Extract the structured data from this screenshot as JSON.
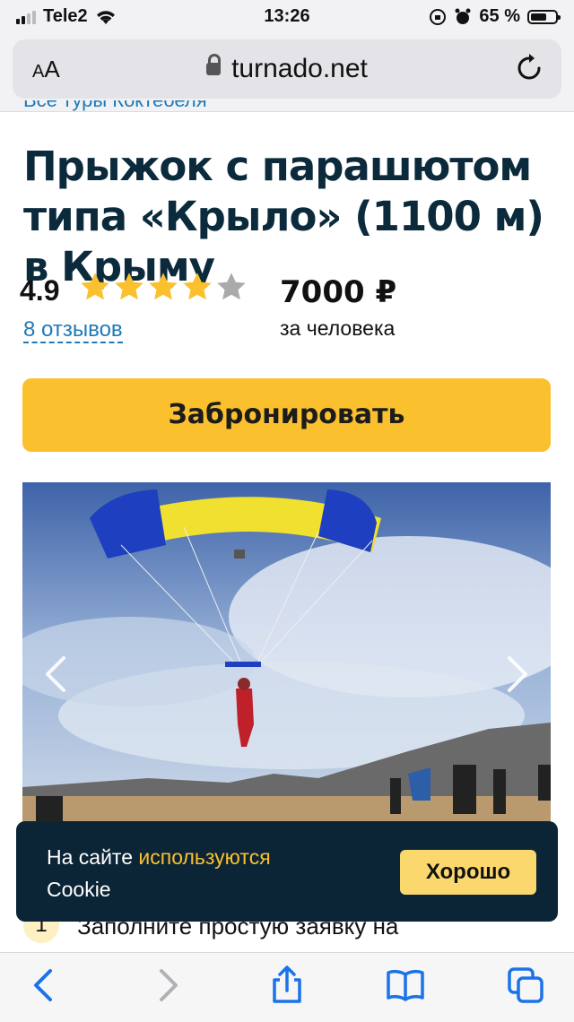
{
  "status_bar": {
    "carrier": "Tele2",
    "time": "13:26",
    "battery": "65 %",
    "battery_level": 0.65
  },
  "browser": {
    "text_size_label": "AA",
    "url": "turnado.net"
  },
  "breadcrumb": "Все туры Коктебеля",
  "title": "Прыжок с парашютом типа «Крыло» (1100 м) в Крыму",
  "rating": {
    "value": "4.9",
    "stars_filled": 4,
    "stars_total": 5,
    "reviews_label": "8 отзывов"
  },
  "price": {
    "amount": "7000 ₽",
    "unit": "за человека"
  },
  "book_button": "Забронировать",
  "step": {
    "number": "1",
    "text": "Заполните простую заявку на"
  },
  "cookie": {
    "text_before": "На сайте",
    "text_highlight": "используются",
    "text_after": "Cookie",
    "ok_label": "Хорошо"
  },
  "colors": {
    "accent": "#fbc02d",
    "link": "#1f7ab8",
    "title": "#0b2a3c",
    "cookie_bg": "#0b2536"
  },
  "icons": [
    "lock-icon",
    "reload-icon",
    "star-icon",
    "chevron-left-icon",
    "chevron-right-icon",
    "back-icon",
    "forward-icon",
    "share-icon",
    "bookmarks-icon",
    "tabs-icon"
  ]
}
